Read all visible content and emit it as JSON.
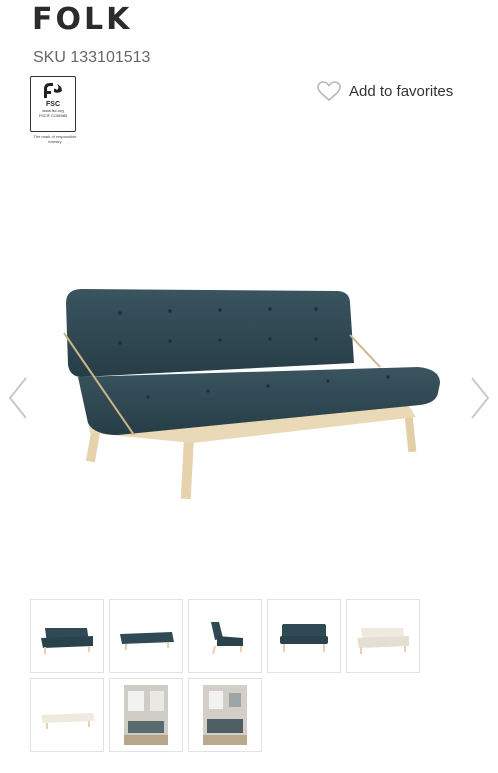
{
  "product": {
    "name": "FOLK",
    "sku": "SKU 133101513"
  },
  "fsc": {
    "logo_text": "FSC",
    "url": "www.fsc.org",
    "code": "FSC® C108980",
    "caption": "The mark of responsible forestry"
  },
  "favorites": {
    "label": "Add to favorites",
    "icon": "heart-outline-icon"
  },
  "gallery": {
    "prev_icon": "chevron-left-icon",
    "next_icon": "chevron-right-icon",
    "thumbnails": [
      "sofa-angle-blue",
      "bed-flat-blue",
      "sofa-side-blue",
      "sofa-front-blue",
      "sofa-angle-white",
      "bed-flat-white",
      "room-scene-1",
      "room-scene-2"
    ]
  },
  "colors": {
    "cushion": "#2f4a55",
    "wood": "#e6d3ae",
    "border": "#e2e2e2"
  }
}
